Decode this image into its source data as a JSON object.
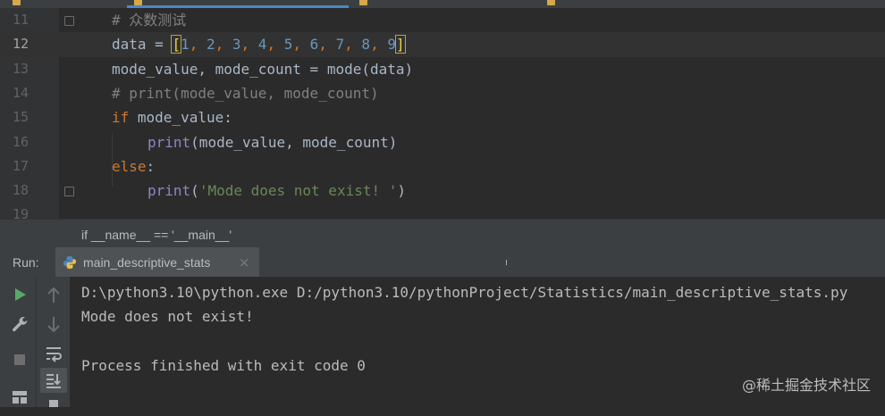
{
  "editor": {
    "lines": [
      {
        "num": "11",
        "comment": "# 众数测试"
      },
      {
        "num": "12",
        "lead": "data = ",
        "bracket_open": "[",
        "items": [
          "1",
          "2",
          "3",
          "4",
          "5",
          "6",
          "7",
          "8",
          "9"
        ],
        "bracket_close": "]"
      },
      {
        "num": "13",
        "text": "mode_value, mode_count = mode(data)"
      },
      {
        "num": "14",
        "comment": "# print(mode_value, mode_count)"
      },
      {
        "num": "15",
        "kw": "if",
        "text": " mode_value:"
      },
      {
        "num": "16",
        "fn": "print",
        "text": "(mode_value, mode_count)"
      },
      {
        "num": "17",
        "kw": "else",
        "text": ":"
      },
      {
        "num": "18",
        "fn": "print",
        "paren_open": "(",
        "str": "'Mode does not exist! '",
        "paren_close": ")"
      },
      {
        "num": "19"
      }
    ]
  },
  "breadcrumb": {
    "text": "if __name__ == '__main__'"
  },
  "run": {
    "label": "Run:",
    "tab_name": "main_descriptive_stats",
    "close_symbol": "×"
  },
  "console": {
    "lines": [
      "D:\\python3.10\\python.exe D:/python3.10/pythonProject/Statistics/main_descriptive_stats.py",
      "Mode does not exist!",
      "",
      "Process finished with exit code 0"
    ]
  },
  "watermark": "@稀土掘金技术社区",
  "icons": [
    "run-icon",
    "arrow-up-icon",
    "wrench-icon",
    "arrow-down-icon",
    "stop-icon",
    "soft-wrap-icon",
    "layout-icon",
    "scroll-to-end-icon",
    "print-icon",
    "python-file-icon",
    "fold-icon"
  ],
  "colors": {
    "keyword": "#cc7832",
    "number": "#6897bb",
    "string": "#6a8759",
    "comment": "#808080",
    "builtin": "#8888c6",
    "run_green": "#59a869"
  }
}
